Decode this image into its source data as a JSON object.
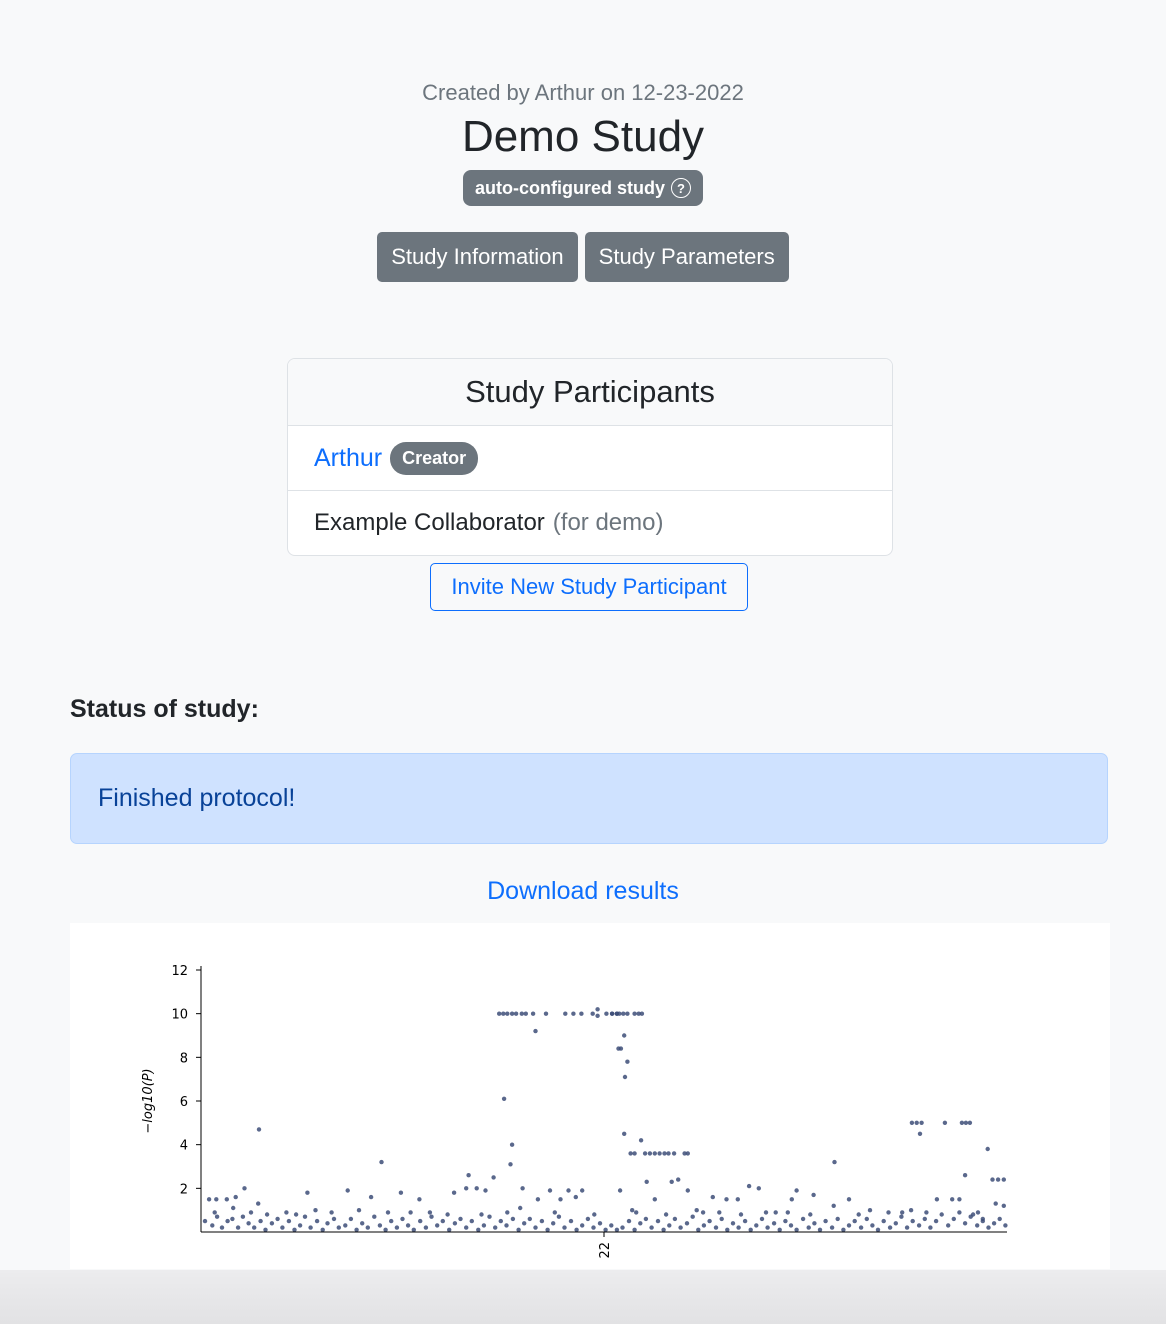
{
  "header": {
    "created_by": "Created by Arthur on 12-23-2022",
    "title": "Demo Study",
    "badge": "auto-configured study",
    "badge_icon": "question-circle-icon"
  },
  "buttons": {
    "study_information": "Study Information",
    "study_parameters": "Study Parameters"
  },
  "participants": {
    "heading": "Study Participants",
    "items": [
      {
        "name": "Arthur",
        "badge": "Creator"
      },
      {
        "name": "Example Collaborator",
        "note": "(for demo)"
      }
    ],
    "invite_label": "Invite New Study Participant"
  },
  "status": {
    "label": "Status of study:",
    "message": "Finished protocol!"
  },
  "download_label": "Download results",
  "colors": {
    "primary": "#0d6efd",
    "secondary": "#6c757d",
    "alert_bg": "#cfe2ff",
    "alert_text": "#084298",
    "point": "#3d4e78"
  },
  "chart_data": {
    "type": "scatter",
    "title": "",
    "xlabel": "",
    "ylabel": "−log10(P)",
    "y_ticks": [
      "2",
      "4",
      "6",
      "8",
      "10",
      "12"
    ],
    "x_ticks": [
      "22"
    ],
    "ylim": [
      0,
      12
    ],
    "xlim": [
      0,
      100
    ],
    "grid": false,
    "series": [
      {
        "points": [
          [
            37.0,
            10
          ],
          [
            37.5,
            10
          ],
          [
            38.0,
            10
          ],
          [
            38.6,
            10
          ],
          [
            39.1,
            10
          ],
          [
            39.8,
            10
          ],
          [
            40.3,
            10
          ],
          [
            41.2,
            10
          ],
          [
            42.8,
            10
          ],
          [
            45.2,
            10
          ],
          [
            46.2,
            10
          ],
          [
            47.2,
            10
          ],
          [
            48.6,
            10
          ],
          [
            49.2,
            10.2
          ],
          [
            50.3,
            10
          ],
          [
            51.0,
            10
          ],
          [
            51.6,
            10
          ],
          [
            52.4,
            10
          ],
          [
            52.9,
            10
          ],
          [
            53.8,
            10
          ],
          [
            54.3,
            10
          ],
          [
            54.7,
            10
          ],
          [
            41.5,
            9.2
          ],
          [
            49.2,
            9.9
          ],
          [
            52.5,
            9.0
          ],
          [
            52.9,
            7.8
          ],
          [
            52.6,
            7.1
          ],
          [
            51.0,
            10
          ],
          [
            51.6,
            10
          ],
          [
            51.9,
            10
          ],
          [
            51.8,
            8.4
          ],
          [
            52.1,
            8.4
          ],
          [
            37.6,
            6.1
          ],
          [
            38.6,
            4.0
          ],
          [
            38.4,
            3.1
          ],
          [
            52.5,
            4.5
          ],
          [
            53.3,
            3.6
          ],
          [
            53.8,
            3.6
          ],
          [
            54.6,
            4.2
          ],
          [
            55.1,
            3.6
          ],
          [
            55.7,
            3.6
          ],
          [
            56.3,
            3.6
          ],
          [
            56.9,
            3.6
          ],
          [
            57.5,
            3.6
          ],
          [
            58.0,
            3.6
          ],
          [
            58.7,
            3.6
          ],
          [
            60.0,
            3.6
          ],
          [
            60.4,
            3.6
          ],
          [
            7.2,
            4.7
          ],
          [
            22.4,
            3.2
          ],
          [
            33.2,
            2.6
          ],
          [
            55.3,
            2.3
          ],
          [
            59.2,
            2.4
          ],
          [
            78.6,
            3.2
          ],
          [
            88.2,
            5.0
          ],
          [
            88.8,
            5.0
          ],
          [
            89.4,
            5.0
          ],
          [
            92.3,
            5.0
          ],
          [
            94.4,
            5.0
          ],
          [
            94.9,
            5.0
          ],
          [
            95.4,
            5.0
          ],
          [
            94.8,
            2.6
          ],
          [
            97.6,
            3.8
          ],
          [
            98.2,
            2.4
          ],
          [
            98.9,
            2.4
          ],
          [
            99.6,
            2.4
          ],
          [
            89.2,
            4.5
          ],
          [
            1.0,
            1.5
          ],
          [
            1.9,
            1.5
          ],
          [
            3.2,
            1.5
          ],
          [
            4.3,
            1.6
          ],
          [
            5.4,
            2.0
          ],
          [
            4.0,
            1.1
          ],
          [
            7.1,
            1.3
          ],
          [
            8.2,
            0.8
          ],
          [
            10.6,
            0.9
          ],
          [
            13.2,
            1.8
          ],
          [
            14.2,
            1.0
          ],
          [
            18.2,
            1.9
          ],
          [
            19.6,
            1.0
          ],
          [
            21.1,
            1.6
          ],
          [
            24.8,
            1.8
          ],
          [
            27.1,
            1.5
          ],
          [
            28.4,
            0.9
          ],
          [
            31.4,
            1.8
          ],
          [
            32.9,
            2.0
          ],
          [
            34.2,
            2.0
          ],
          [
            35.3,
            1.9
          ],
          [
            36.3,
            2.5
          ],
          [
            39.6,
            1.1
          ],
          [
            39.9,
            2.0
          ],
          [
            41.8,
            1.5
          ],
          [
            43.3,
            1.9
          ],
          [
            44.6,
            1.5
          ],
          [
            45.6,
            1.9
          ],
          [
            46.5,
            1.6
          ],
          [
            47.3,
            1.9
          ],
          [
            52.0,
            1.9
          ],
          [
            53.5,
            1.0
          ],
          [
            56.3,
            1.5
          ],
          [
            58.4,
            2.3
          ],
          [
            60.4,
            1.9
          ],
          [
            61.5,
            1.0
          ],
          [
            62.3,
            0.9
          ],
          [
            63.5,
            1.6
          ],
          [
            65.2,
            1.5
          ],
          [
            66.6,
            1.5
          ],
          [
            68.0,
            2.1
          ],
          [
            69.2,
            2.0
          ],
          [
            70.1,
            0.9
          ],
          [
            71.3,
            0.9
          ],
          [
            73.3,
            1.5
          ],
          [
            73.9,
            1.9
          ],
          [
            76.0,
            1.7
          ],
          [
            78.5,
            1.2
          ],
          [
            80.4,
            1.5
          ],
          [
            83.0,
            1.0
          ],
          [
            85.3,
            0.9
          ],
          [
            88.1,
            1.0
          ],
          [
            91.3,
            1.5
          ],
          [
            93.2,
            1.5
          ],
          [
            94.1,
            1.5
          ],
          [
            96.4,
            0.9
          ],
          [
            97.0,
            0.6
          ],
          [
            98.6,
            1.3
          ],
          [
            99.6,
            1.2
          ],
          [
            0.5,
            0.5
          ],
          [
            1.4,
            0.3
          ],
          [
            2.0,
            0.7
          ],
          [
            2.6,
            0.2
          ],
          [
            3.3,
            0.5
          ],
          [
            3.9,
            0.6
          ],
          [
            4.6,
            0.2
          ],
          [
            5.2,
            0.7
          ],
          [
            5.9,
            0.4
          ],
          [
            6.6,
            0.2
          ],
          [
            7.4,
            0.5
          ],
          [
            8.0,
            0.1
          ],
          [
            8.8,
            0.4
          ],
          [
            9.5,
            0.6
          ],
          [
            10.1,
            0.2
          ],
          [
            10.9,
            0.5
          ],
          [
            11.6,
            0.1
          ],
          [
            12.3,
            0.3
          ],
          [
            12.9,
            0.7
          ],
          [
            13.6,
            0.2
          ],
          [
            14.4,
            0.5
          ],
          [
            15.1,
            0.1
          ],
          [
            15.7,
            0.4
          ],
          [
            16.5,
            0.6
          ],
          [
            17.1,
            0.2
          ],
          [
            17.9,
            0.3
          ],
          [
            18.6,
            0.6
          ],
          [
            19.3,
            0.1
          ],
          [
            20.0,
            0.4
          ],
          [
            20.7,
            0.2
          ],
          [
            21.5,
            0.7
          ],
          [
            22.2,
            0.3
          ],
          [
            22.9,
            0.1
          ],
          [
            23.6,
            0.5
          ],
          [
            24.3,
            0.2
          ],
          [
            25.0,
            0.6
          ],
          [
            25.7,
            0.3
          ],
          [
            26.4,
            0.1
          ],
          [
            27.2,
            0.5
          ],
          [
            27.9,
            0.2
          ],
          [
            28.6,
            0.7
          ],
          [
            29.3,
            0.3
          ],
          [
            30.0,
            0.5
          ],
          [
            30.8,
            0.1
          ],
          [
            31.5,
            0.4
          ],
          [
            32.2,
            0.6
          ],
          [
            32.9,
            0.2
          ],
          [
            33.6,
            0.5
          ],
          [
            34.4,
            0.1
          ],
          [
            35.1,
            0.3
          ],
          [
            35.8,
            0.7
          ],
          [
            36.5,
            0.2
          ],
          [
            37.2,
            0.5
          ],
          [
            37.9,
            0.3
          ],
          [
            38.7,
            0.6
          ],
          [
            39.4,
            0.1
          ],
          [
            40.1,
            0.4
          ],
          [
            40.8,
            0.6
          ],
          [
            41.5,
            0.2
          ],
          [
            42.3,
            0.5
          ],
          [
            43.0,
            0.1
          ],
          [
            43.7,
            0.4
          ],
          [
            44.4,
            0.7
          ],
          [
            45.1,
            0.2
          ],
          [
            45.9,
            0.5
          ],
          [
            46.6,
            0.1
          ],
          [
            47.3,
            0.3
          ],
          [
            48.0,
            0.6
          ],
          [
            48.7,
            0.2
          ],
          [
            49.5,
            0.4
          ],
          [
            50.2,
            0.1
          ],
          [
            50.9,
            0.3
          ],
          [
            51.6,
            0.1
          ],
          [
            52.3,
            0.2
          ],
          [
            53.1,
            0.5
          ],
          [
            53.8,
            0.1
          ],
          [
            54.5,
            0.4
          ],
          [
            55.2,
            0.6
          ],
          [
            55.9,
            0.2
          ],
          [
            56.7,
            0.5
          ],
          [
            57.4,
            0.1
          ],
          [
            58.1,
            0.3
          ],
          [
            58.8,
            0.6
          ],
          [
            59.5,
            0.2
          ],
          [
            60.3,
            0.4
          ],
          [
            61.0,
            0.7
          ],
          [
            61.7,
            0.1
          ],
          [
            62.4,
            0.3
          ],
          [
            63.1,
            0.5
          ],
          [
            63.9,
            0.2
          ],
          [
            64.6,
            0.6
          ],
          [
            65.3,
            0.1
          ],
          [
            66.0,
            0.4
          ],
          [
            66.7,
            0.2
          ],
          [
            67.5,
            0.5
          ],
          [
            68.2,
            0.1
          ],
          [
            68.9,
            0.3
          ],
          [
            69.6,
            0.6
          ],
          [
            70.3,
            0.2
          ],
          [
            71.1,
            0.4
          ],
          [
            71.8,
            0.1
          ],
          [
            72.5,
            0.5
          ],
          [
            73.2,
            0.3
          ],
          [
            73.9,
            0.1
          ],
          [
            74.7,
            0.6
          ],
          [
            75.4,
            0.2
          ],
          [
            76.1,
            0.4
          ],
          [
            76.8,
            0.1
          ],
          [
            77.5,
            0.5
          ],
          [
            78.3,
            0.2
          ],
          [
            79.0,
            0.6
          ],
          [
            79.7,
            0.1
          ],
          [
            80.4,
            0.3
          ],
          [
            81.1,
            0.5
          ],
          [
            81.9,
            0.2
          ],
          [
            82.6,
            0.6
          ],
          [
            83.3,
            0.3
          ],
          [
            84.0,
            0.1
          ],
          [
            84.7,
            0.5
          ],
          [
            85.5,
            0.2
          ],
          [
            86.2,
            0.4
          ],
          [
            86.9,
            0.7
          ],
          [
            87.6,
            0.2
          ],
          [
            88.3,
            0.5
          ],
          [
            89.1,
            0.3
          ],
          [
            89.8,
            0.6
          ],
          [
            90.5,
            0.2
          ],
          [
            91.2,
            0.5
          ],
          [
            91.9,
            0.8
          ],
          [
            92.7,
            0.3
          ],
          [
            93.4,
            0.6
          ],
          [
            94.1,
            0.9
          ],
          [
            94.8,
            0.4
          ],
          [
            95.5,
            0.7
          ],
          [
            96.3,
            0.3
          ],
          [
            97.0,
            0.5
          ],
          [
            97.7,
            0.2
          ],
          [
            98.4,
            0.4
          ],
          [
            99.1,
            0.6
          ],
          [
            99.8,
            0.3
          ],
          [
            1.7,
            0.9
          ],
          [
            6.2,
            0.9
          ],
          [
            11.8,
            0.8
          ],
          [
            16.2,
            0.9
          ],
          [
            23.2,
            0.9
          ],
          [
            26.0,
            0.9
          ],
          [
            30.6,
            0.8
          ],
          [
            34.8,
            0.8
          ],
          [
            38.0,
            0.9
          ],
          [
            43.9,
            0.9
          ],
          [
            48.8,
            0.8
          ],
          [
            54.0,
            0.9
          ],
          [
            57.7,
            0.8
          ],
          [
            64.3,
            0.9
          ],
          [
            67.0,
            0.8
          ],
          [
            72.8,
            0.9
          ],
          [
            75.6,
            0.8
          ],
          [
            81.6,
            0.8
          ],
          [
            87.0,
            0.9
          ],
          [
            90.0,
            0.9
          ],
          [
            95.8,
            0.8
          ]
        ]
      }
    ]
  }
}
